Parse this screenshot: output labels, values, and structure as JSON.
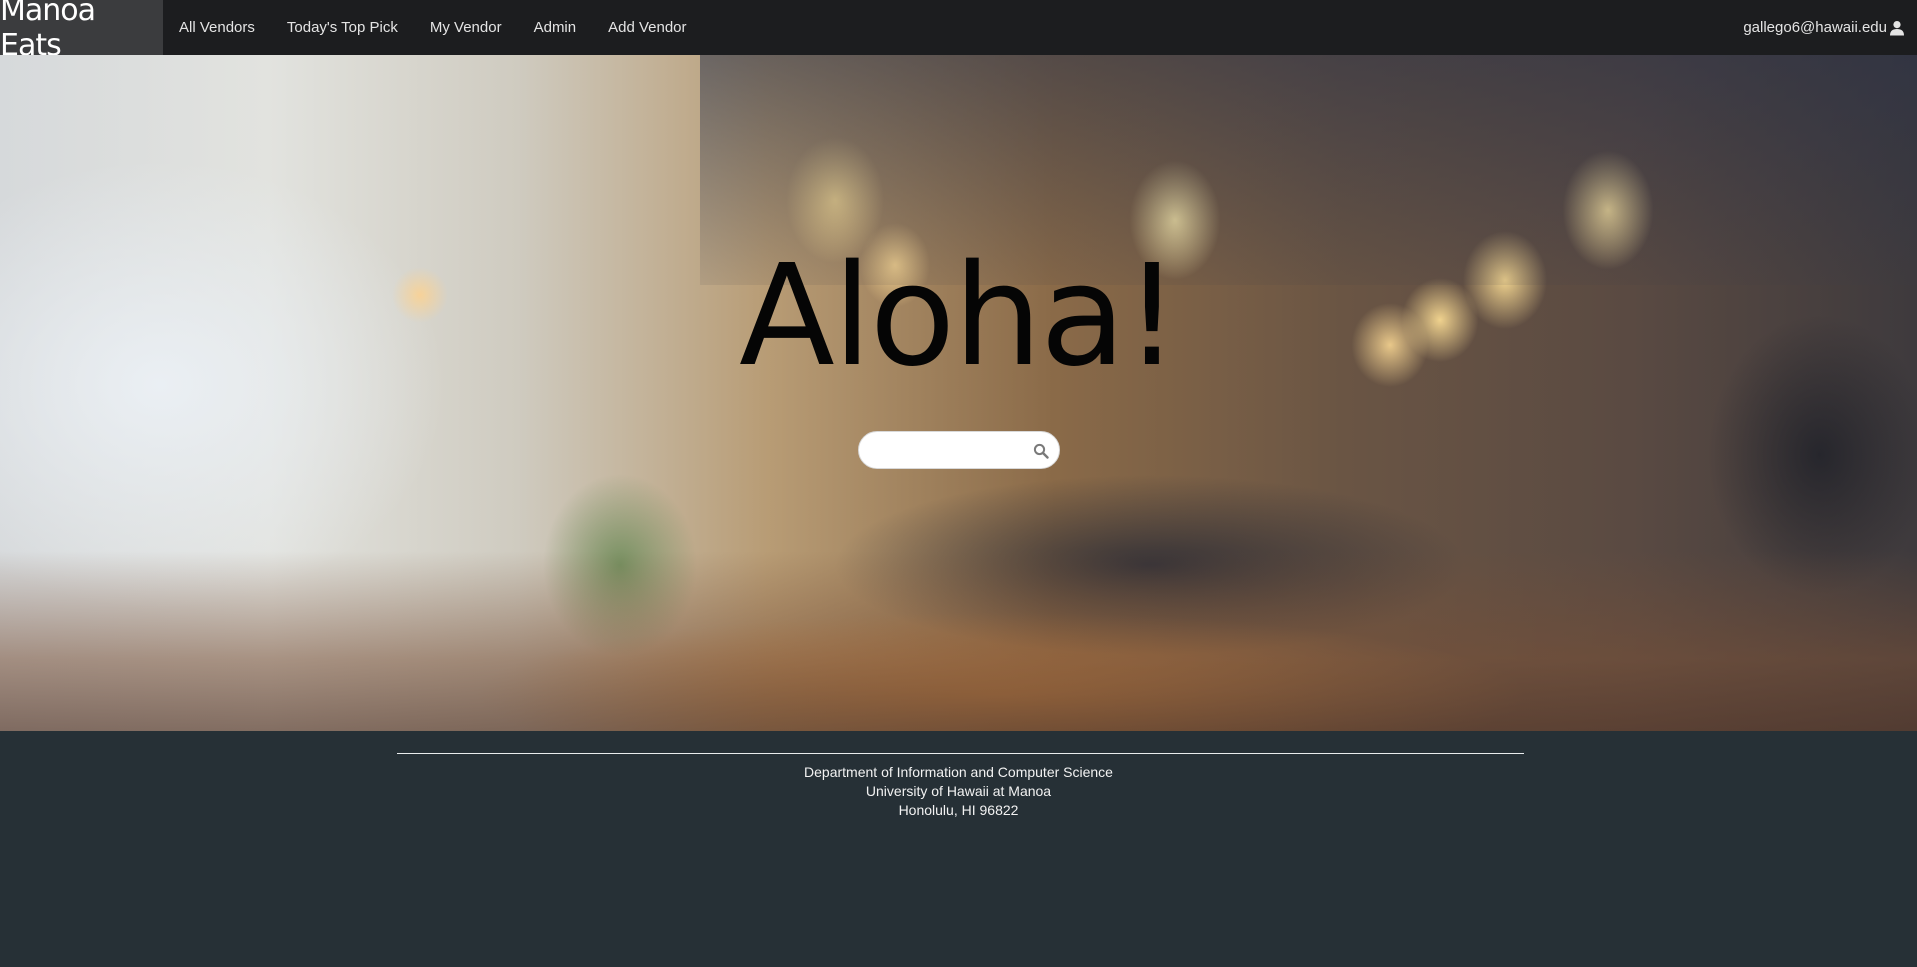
{
  "navbar": {
    "brand": "Manoa Eats",
    "items": [
      {
        "label": "All Vendors"
      },
      {
        "label": "Today's Top Pick"
      },
      {
        "label": "My Vendor"
      },
      {
        "label": "Admin"
      },
      {
        "label": "Add Vendor"
      }
    ],
    "user_email": "gallego6@hawaii.edu",
    "user_icon": "user-icon"
  },
  "hero": {
    "title": "Aloha!",
    "search": {
      "value": "",
      "placeholder": "",
      "icon": "search-icon"
    }
  },
  "footer": {
    "line1": "Department of Information and Computer Science",
    "line2": "University of Hawaii at Manoa",
    "line3": "Honolulu, HI 96822"
  },
  "colors": {
    "navbar_bg": "#1c1d1f",
    "brand_bg": "#3b3c3e",
    "footer_bg": "#263036"
  }
}
